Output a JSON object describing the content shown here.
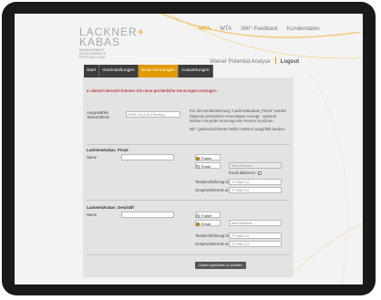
{
  "brand": {
    "logo_top": "LACKNER",
    "logo_amp": "+",
    "logo_bottom": "KABAS",
    "logo_sub": [
      "MANAGEMENT",
      "ASSESSMENTS",
      "PSYCHOLOGIE"
    ],
    "accent_color": "#e39a00"
  },
  "topnav": {
    "items": [
      {
        "label": "WPA",
        "active": true
      },
      {
        "label": "WTA",
        "active": false
      },
      {
        "label": "360°-Feedback",
        "active": false
      },
      {
        "label": "Kundendaten",
        "active": false
      }
    ]
  },
  "subnav": {
    "section": "Wiener Potential Analyse",
    "logout": "Logout"
  },
  "tabs": [
    {
      "label": "Start",
      "active": false
    },
    {
      "label": "Voreinstellungen",
      "active": false
    },
    {
      "label": "Neue Kennungen",
      "active": true
    },
    {
      "label": "Auswertungen",
      "active": false
    }
  ],
  "form": {
    "notice": "In diesem Bereich können Sie neue persönliche Kennungen erzeugen.",
    "test_label_1": "Ausgewählte",
    "test_label_2": "Testverfahren",
    "test_select": "WPA 15 (3.0) Führung",
    "help_text": "Für die Kundenkennung \"Lackner&Kabas_Privat\" wurden folgende persönliche Kennungen erzeugt - optional können Sie jeder Kennung eine Person zuordnen:",
    "required_star": "Mit * gekennzeichnete Felder müssen ausgefüllt werden.",
    "sections": [
      {
        "title": "Lackner&Kabas_Privat",
        "name_label": "Name",
        "name_value": "",
        "radio_1": "Father",
        "radio_2": "Email",
        "mail_placeholder": "Mail Adresse",
        "mail_checkbox_label": "Email aktivieren",
        "date1_label": "Testdurchführung bis",
        "date1_value": "TT.MM.JJJ",
        "date2_label": "Gesprächstermin am",
        "date2_value": "TT.MM.JJJ"
      },
      {
        "title": "Lackner&Kabas_Geschäft",
        "name_label": "Name",
        "name_value": "",
        "radio_1": "Father",
        "radio_2": "Email",
        "mail_placeholder": "Mail Adresse",
        "date1_label": "Testdurchführung bis",
        "date1_value": "TT.MM.JJJ",
        "date2_label": "Gesprächstermin am",
        "date2_value": "TT.MM.JJJ"
      }
    ],
    "submit_label": "Daten speichern & senden"
  }
}
